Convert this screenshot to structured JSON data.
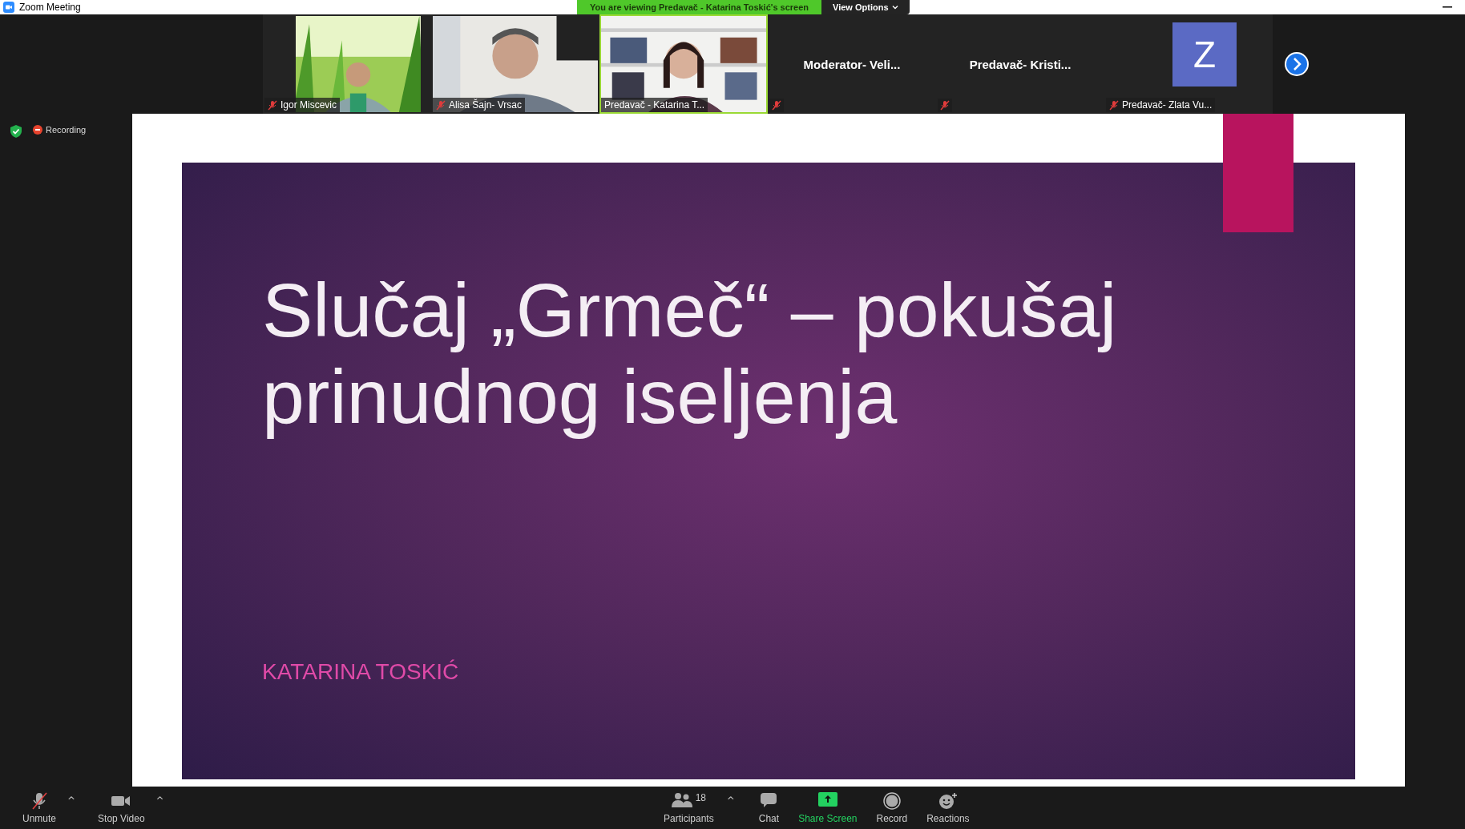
{
  "window": {
    "title": "Zoom Meeting"
  },
  "banner": {
    "text": "You are viewing Predavač - Katarina Toskić's screen",
    "view_options": "View Options"
  },
  "participants": [
    {
      "kind": "video",
      "name": "Igor Miscevic",
      "muted": true,
      "selected": false
    },
    {
      "kind": "video",
      "name": "Alisa Šajn- Vrsac",
      "muted": true,
      "selected": false
    },
    {
      "kind": "video",
      "name": "Predavač - Katarina T...",
      "muted": false,
      "selected": true
    },
    {
      "kind": "name",
      "name": "Moderator-  Veli...",
      "muted": true,
      "selected": false
    },
    {
      "kind": "name",
      "name": "Predavač-  Kristi...",
      "muted": true,
      "selected": false
    },
    {
      "kind": "avatar",
      "initial": "Z",
      "name": "Predavač- Zlata Vu...",
      "muted": true,
      "selected": false
    }
  ],
  "status": {
    "recording": "Recording"
  },
  "slide": {
    "title": "Slučaj „Grmeč“ – pokušaj prinudnog iseljenja",
    "author": "KATARINA TOSKIĆ"
  },
  "toolbar": [
    {
      "kind": "mic",
      "label": "Unmute",
      "caret": "^"
    },
    {
      "kind": "video",
      "label": "Stop Video",
      "caret": "^"
    },
    {
      "kind": "participants",
      "label": "Participants",
      "count": "18",
      "caret": "^"
    },
    {
      "kind": "chat",
      "label": "Chat"
    },
    {
      "kind": "share",
      "label": "Share Screen"
    },
    {
      "kind": "record",
      "label": "Record"
    },
    {
      "kind": "reactions",
      "label": "Reactions"
    }
  ]
}
